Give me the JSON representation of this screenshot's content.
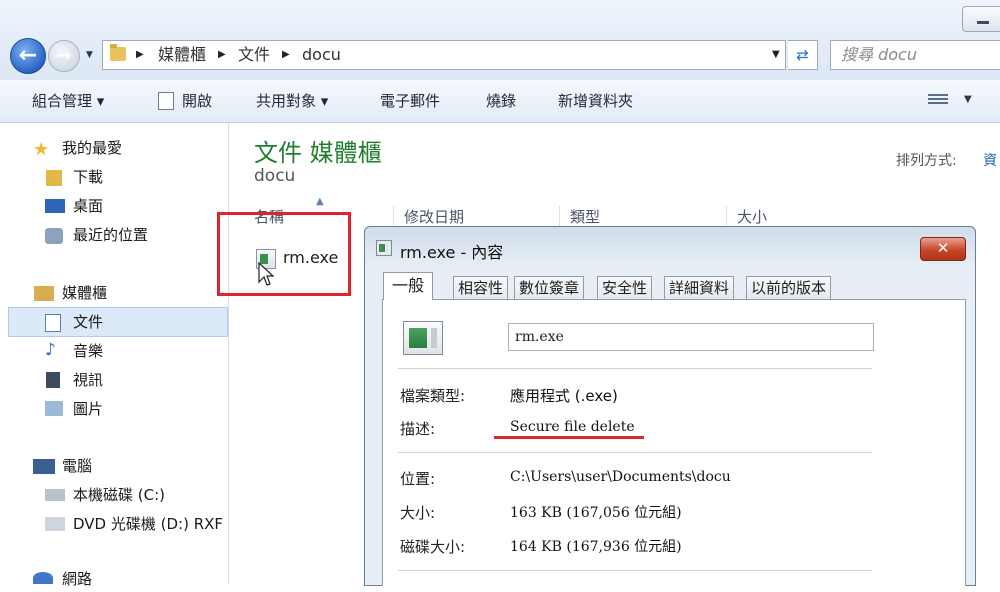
{
  "address": {
    "crumbs": [
      "媒體櫃",
      "文件",
      "docu"
    ],
    "search_placeholder": "搜尋 docu"
  },
  "toolbar": {
    "organize": "組合管理",
    "open": "開啟",
    "share": "共用對象",
    "email": "電子郵件",
    "burn": "燒錄",
    "new_folder": "新增資料夾"
  },
  "sidebar": {
    "favorites": "我的最愛",
    "downloads": "下載",
    "desktop": "桌面",
    "recent": "最近的位置",
    "libraries": "媒體櫃",
    "documents": "文件",
    "music": "音樂",
    "videos": "視訊",
    "pictures": "圖片",
    "computer": "電腦",
    "local_disk": "本機磁碟 (C:)",
    "dvd": "DVD 光碟機 (D:) RXF",
    "network": "網路"
  },
  "library": {
    "title": "文件 媒體櫃",
    "subtitle": "docu",
    "sort_label": "排列方式:",
    "sort_value": "資"
  },
  "columns": [
    "名稱",
    "修改日期",
    "類型",
    "大小"
  ],
  "files": [
    {
      "name": "rm.exe"
    }
  ],
  "dialog": {
    "title": "rm.exe - 內容",
    "tabs": [
      "一般",
      "相容性",
      "數位簽章",
      "安全性",
      "詳細資料",
      "以前的版本"
    ],
    "file_name": "rm.exe",
    "type_label": "檔案類型:",
    "type_value": "應用程式 (.exe)",
    "desc_label": "描述:",
    "desc_value": "Secure file delete",
    "location_label": "位置:",
    "location_value": "C:\\Users\\user\\Documents\\docu",
    "size_label": "大小:",
    "size_value": "163 KB (167,056 位元組)",
    "disk_size_label": "磁碟大小:",
    "disk_size_value": "164 KB (167,936 位元組)"
  },
  "colors": {
    "library_title": "#1f7f2e",
    "highlight_red": "#e0222f",
    "link_blue": "#1d5fb8"
  }
}
